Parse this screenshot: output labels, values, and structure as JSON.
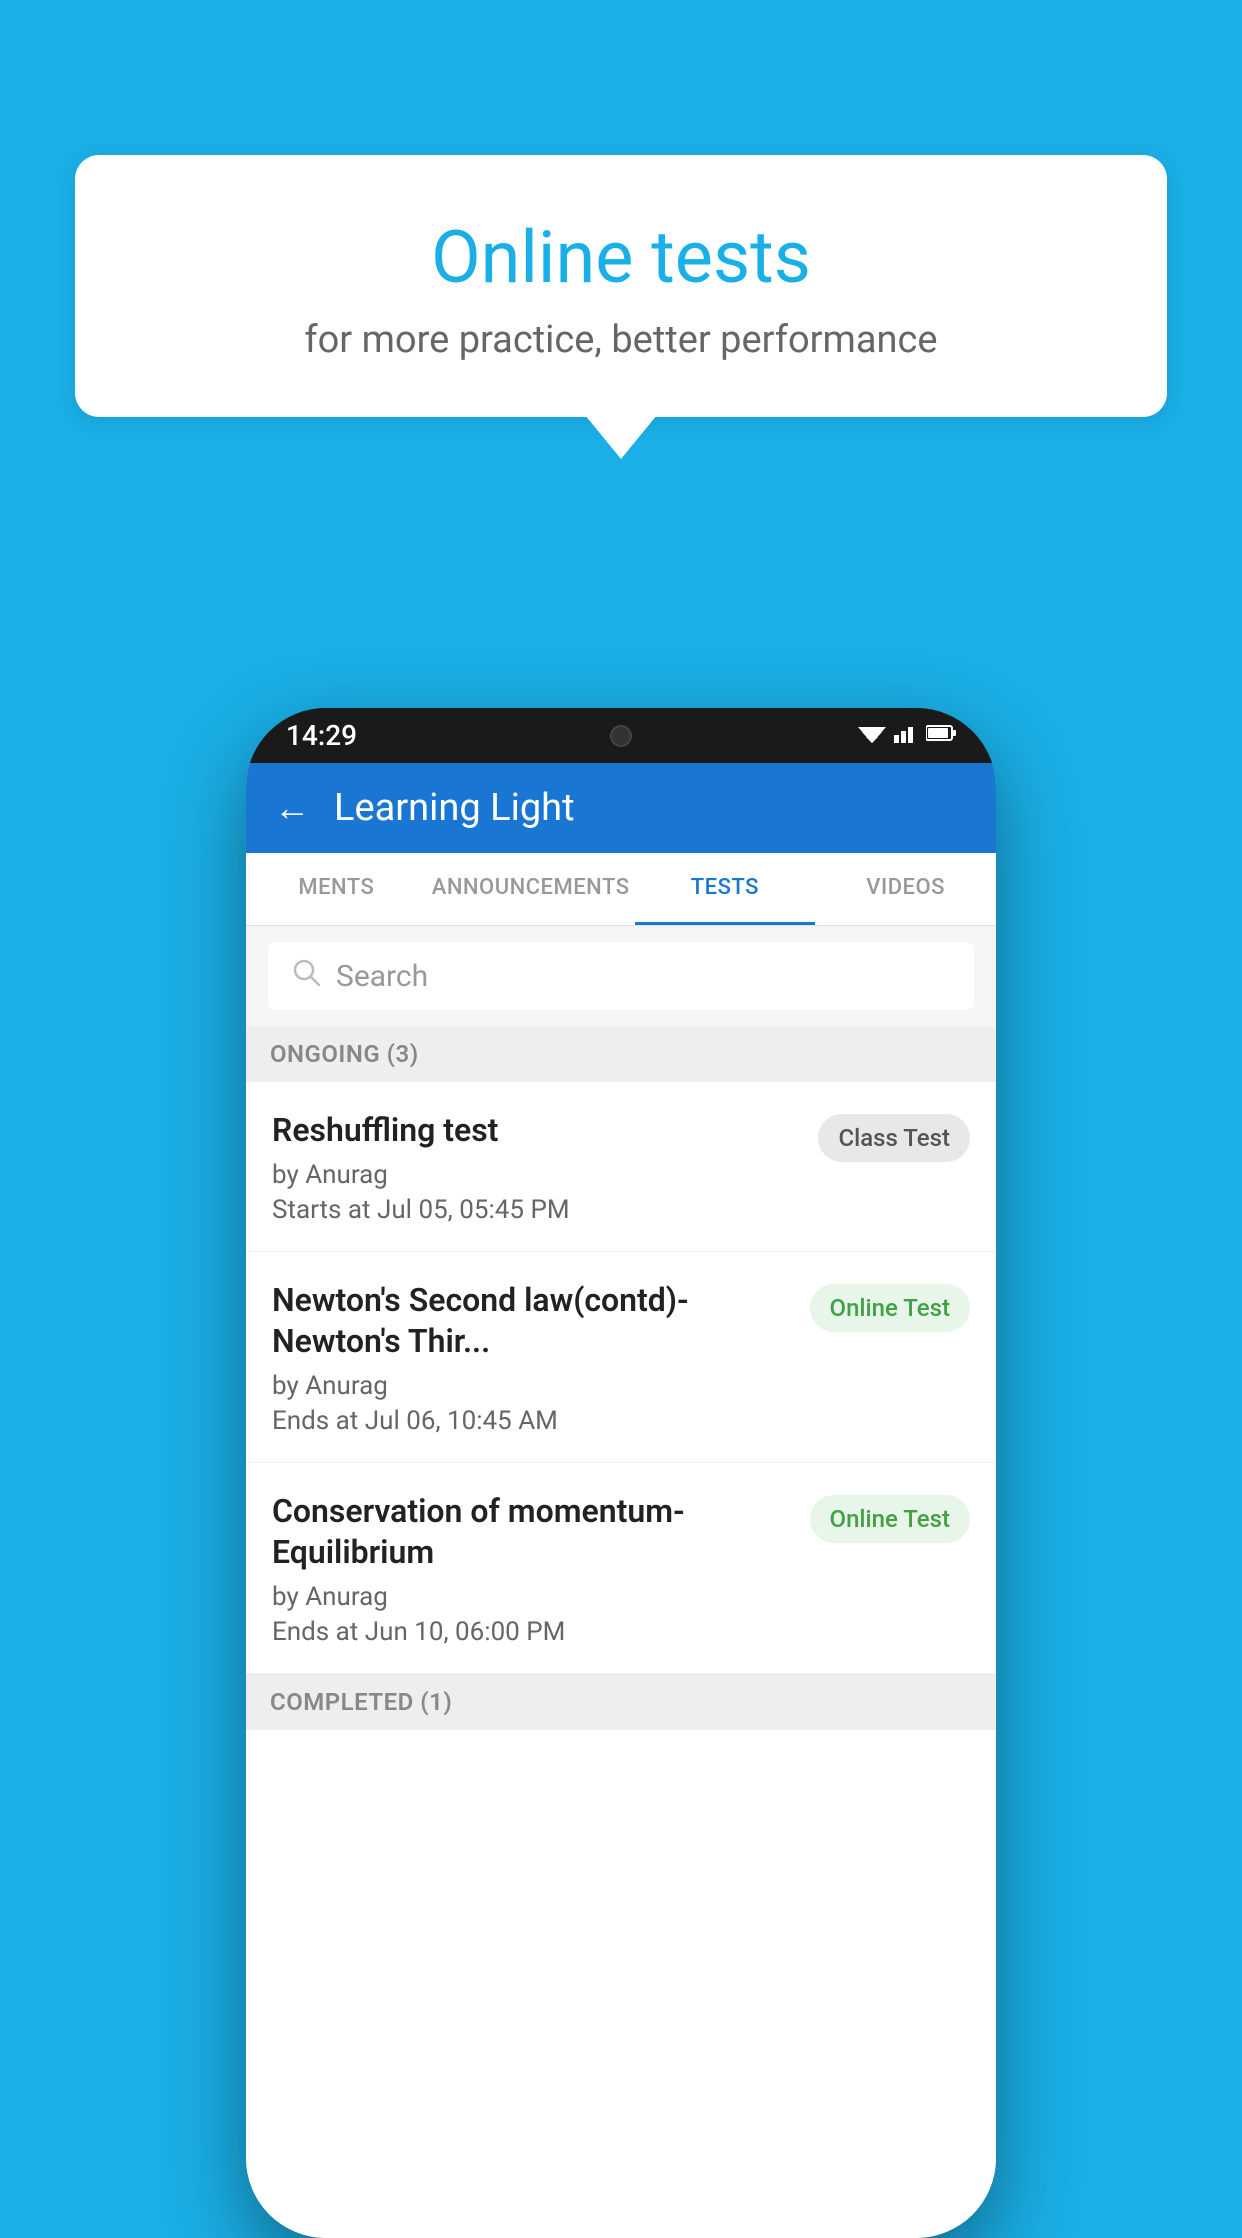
{
  "background_color": "#1AAFE6",
  "speech_bubble": {
    "title": "Online tests",
    "subtitle": "for more practice, better performance"
  },
  "phone": {
    "status_bar": {
      "time": "14:29",
      "wifi": "▾",
      "signal": "◂▸",
      "battery": "▮"
    },
    "app_header": {
      "back_label": "←",
      "title": "Learning Light"
    },
    "tabs": [
      {
        "label": "MENTS",
        "active": false
      },
      {
        "label": "ANNOUNCEMENTS",
        "active": false
      },
      {
        "label": "TESTS",
        "active": true
      },
      {
        "label": "VIDEOS",
        "active": false
      }
    ],
    "search": {
      "placeholder": "Search"
    },
    "ongoing_section": {
      "header": "ONGOING (3)"
    },
    "tests": [
      {
        "name": "Reshuffling test",
        "author": "by Anurag",
        "date": "Starts at  Jul 05, 05:45 PM",
        "badge_text": "Class Test",
        "badge_type": "class"
      },
      {
        "name": "Newton's Second law(contd)-Newton's Thir...",
        "author": "by Anurag",
        "date": "Ends at  Jul 06, 10:45 AM",
        "badge_text": "Online Test",
        "badge_type": "online"
      },
      {
        "name": "Conservation of momentum-Equilibrium",
        "author": "by Anurag",
        "date": "Ends at  Jun 10, 06:00 PM",
        "badge_text": "Online Test",
        "badge_type": "online"
      }
    ],
    "completed_section": {
      "header": "COMPLETED (1)"
    }
  }
}
